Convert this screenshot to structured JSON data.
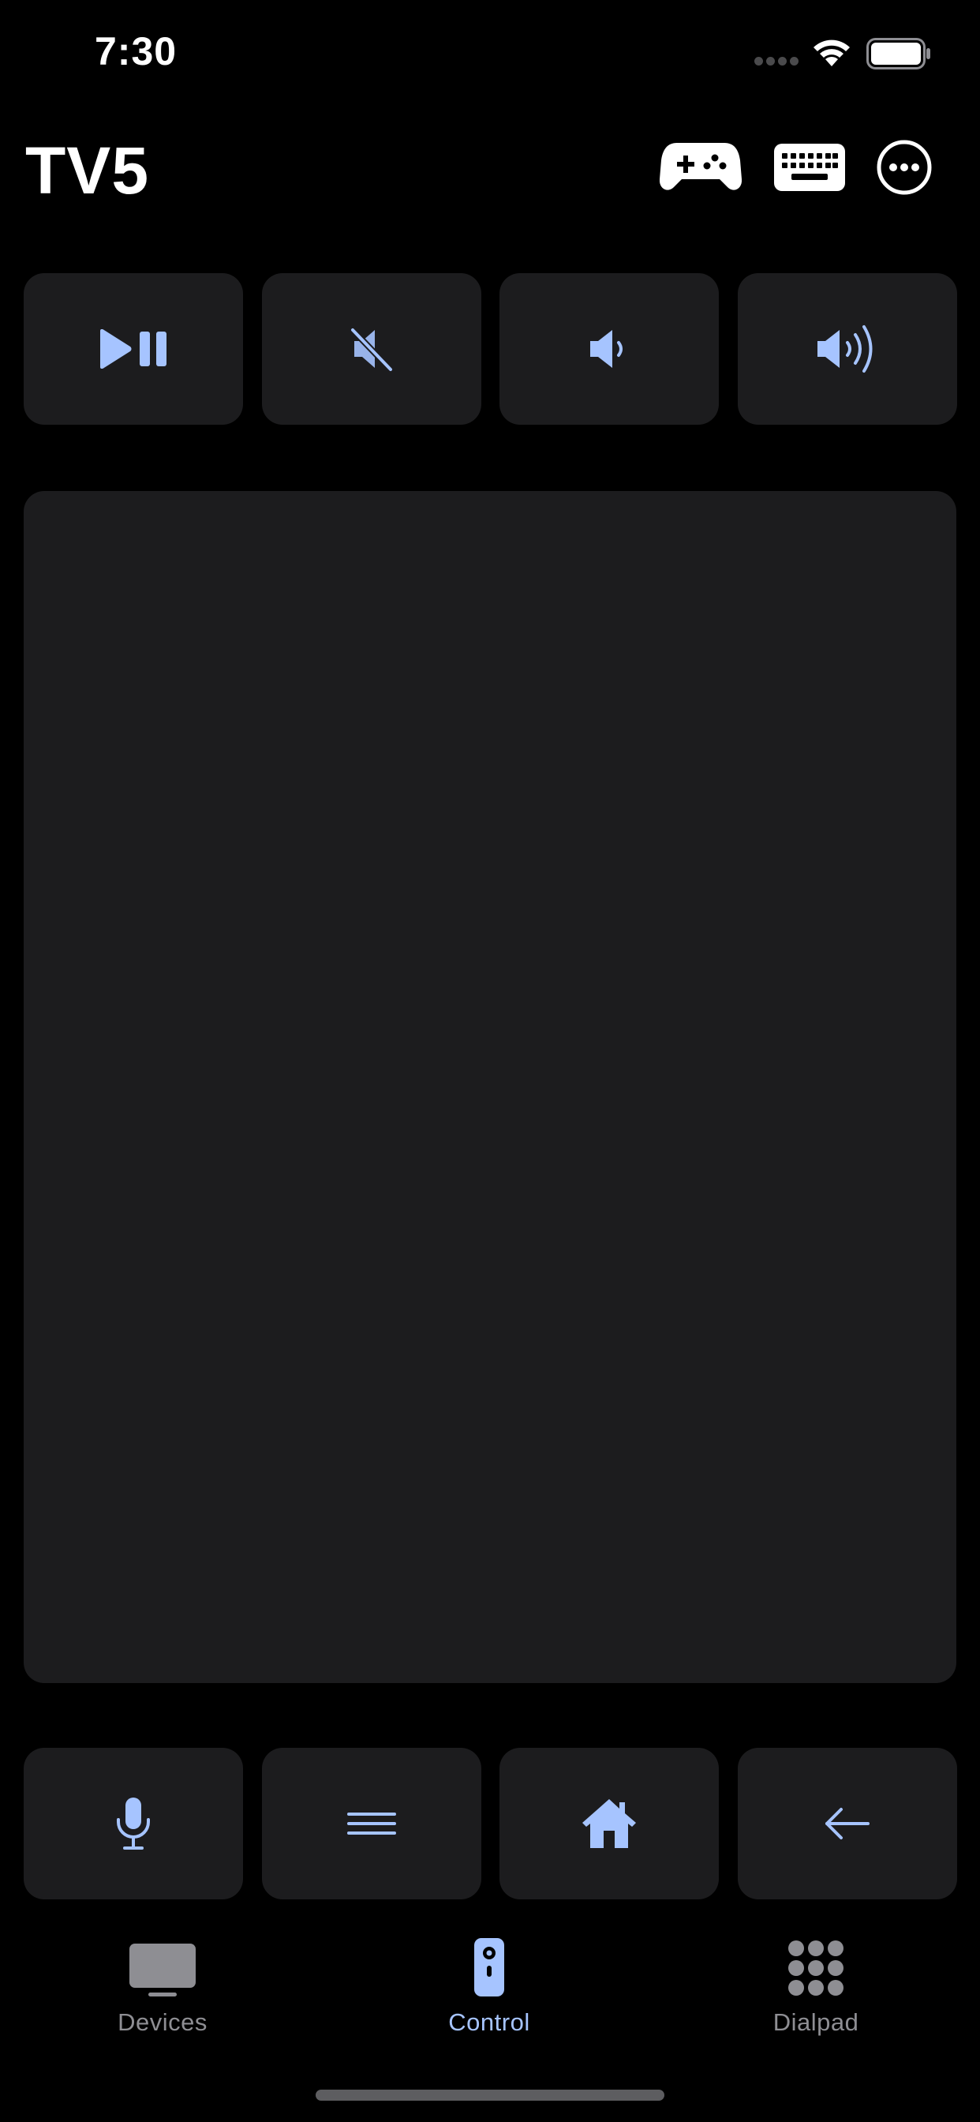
{
  "status_bar": {
    "time": "7:30",
    "icons": [
      "cellular-signal-icon",
      "wifi-icon",
      "battery-icon"
    ]
  },
  "header": {
    "title": "TV5",
    "actions": [
      "gamepad-icon",
      "keyboard-icon",
      "more-icon"
    ]
  },
  "top_controls": [
    {
      "name": "play-pause-button",
      "icon": "play-pause-icon"
    },
    {
      "name": "mute-button",
      "icon": "speaker-muted-icon"
    },
    {
      "name": "volume-down-button",
      "icon": "speaker-low-icon"
    },
    {
      "name": "volume-up-button",
      "icon": "speaker-high-icon"
    }
  ],
  "bottom_controls": [
    {
      "name": "voice-button",
      "icon": "microphone-icon"
    },
    {
      "name": "menu-button",
      "icon": "menu-icon"
    },
    {
      "name": "home-button",
      "icon": "house-icon"
    },
    {
      "name": "back-button",
      "icon": "arrow-left-icon"
    }
  ],
  "tab_bar": {
    "tabs": [
      {
        "label": "Devices",
        "icon": "tv-icon"
      },
      {
        "label": "Control",
        "icon": "remote-icon"
      },
      {
        "label": "Dialpad",
        "icon": "dialpad-icon"
      }
    ],
    "selected": "Control"
  },
  "colors": {
    "background": "#000000",
    "tile": "#1c1c1e",
    "accent": "#a6c4ff",
    "inactive": "#8e8e93"
  }
}
